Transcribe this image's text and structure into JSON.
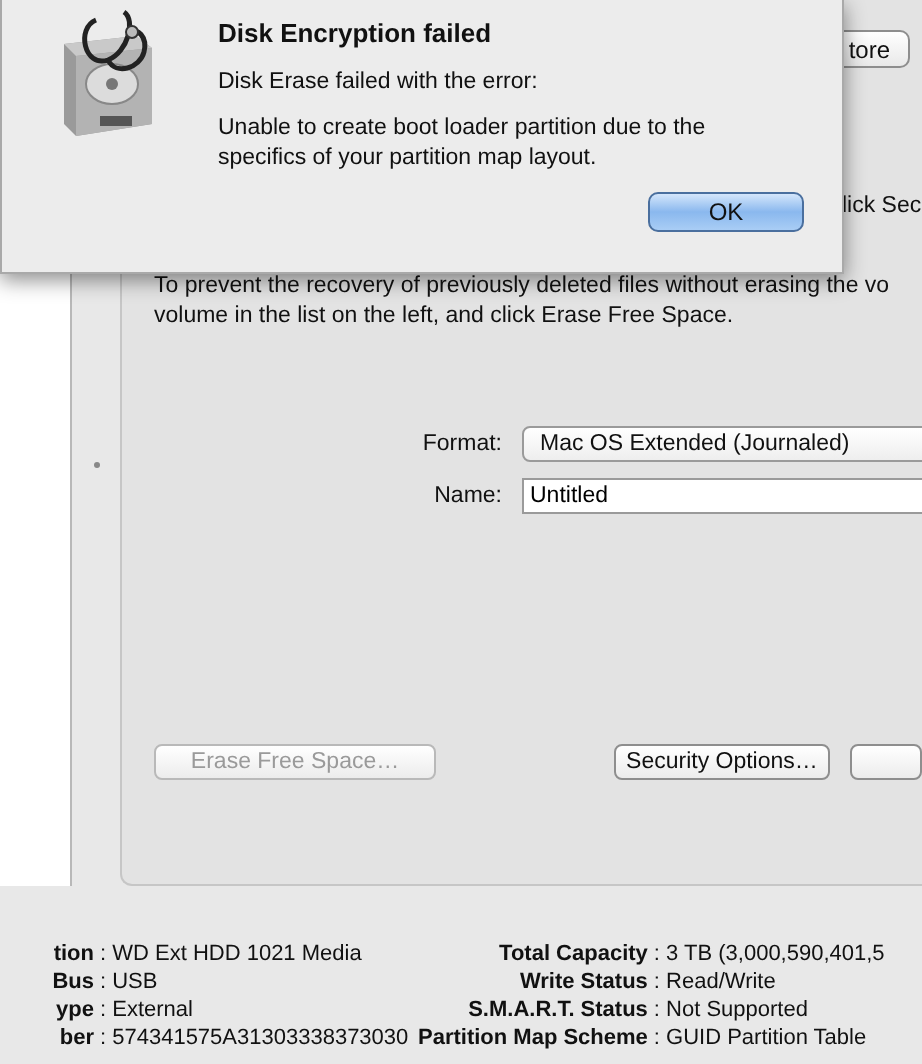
{
  "dialog": {
    "title": "Disk Encryption failed",
    "message": "Disk Erase failed with the error:",
    "detail": "Unable to create boot loader partition due to the specifics of your partition map layout.",
    "buttons": [
      {
        "label": "OK",
        "default": true
      }
    ]
  },
  "tabs": [
    {
      "label": "tore",
      "selected": false
    }
  ],
  "instruction_fragment": "lick Sec",
  "free_space_note": [
    "To prevent the recovery of previously deleted files without erasing the vo",
    "volume in the list on the left, and click Erase Free Space."
  ],
  "format": {
    "label": "Format:",
    "value": "Mac OS Extended (Journaled)"
  },
  "name": {
    "label": "Name:",
    "value": "Untitled"
  },
  "buttons": [
    {
      "label": "Erase Free Space…",
      "disabled": true
    },
    {
      "label": "Security Options…",
      "disabled": false
    }
  ],
  "info_rows": [
    {
      "label": "tion",
      "value": ": WD Ext HDD 1021 Media",
      "label2": "Total Capacity",
      "value2": ": 3 TB (3,000,590,401,5"
    },
    {
      "label": "Bus",
      "value": ": USB",
      "label2": "Write Status",
      "value2": ": Read/Write"
    },
    {
      "label": "ype",
      "value": ": External",
      "label2": "S.M.A.R.T. Status",
      "value2": ": Not Supported"
    },
    {
      "label": "ber",
      "value": ": 574341575A31303338373030",
      "label2": "Partition Map Scheme",
      "value2": ": GUID Partition Table"
    }
  ]
}
